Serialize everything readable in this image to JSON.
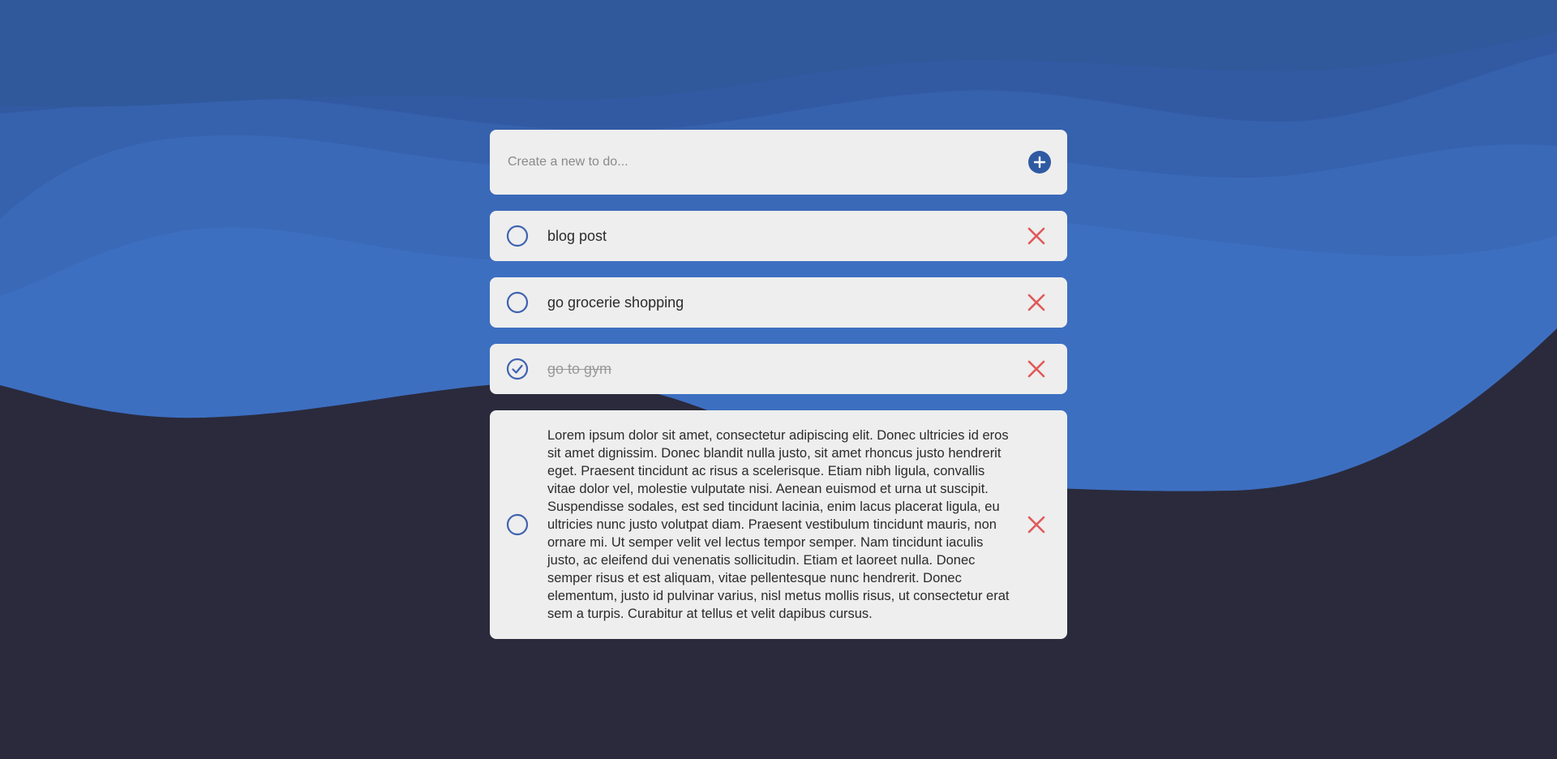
{
  "colors": {
    "background_dark": "#2a2a3c",
    "wave_primary": "#3d6fc1",
    "card_bg": "#eeeeee",
    "accent": "#2f5aa3",
    "check_ring": "#3f63b0",
    "delete": "#e05a5a"
  },
  "new_todo": {
    "placeholder": "Create a new to do...",
    "value": "",
    "add_icon": "plus-circle-icon"
  },
  "todos": [
    {
      "text": "blog post",
      "completed": false
    },
    {
      "text": "go grocerie shopping",
      "completed": false
    },
    {
      "text": "go to gym",
      "completed": true
    },
    {
      "text": "Lorem ipsum dolor sit amet, consectetur adipiscing elit. Donec ultricies id eros sit amet dignissim. Donec blandit nulla justo, sit amet rhoncus justo hendrerit eget. Praesent tincidunt ac risus a scelerisque. Etiam nibh ligula, convallis vitae dolor vel, molestie vulputate nisi. Aenean euismod et urna ut suscipit. Suspendisse sodales, est sed tincidunt lacinia, enim lacus placerat ligula, eu ultricies nunc justo volutpat diam. Praesent vestibulum tincidunt mauris, non ornare mi. Ut semper velit vel lectus tempor semper. Nam tincidunt iaculis justo, ac eleifend dui venenatis sollicitudin. Etiam et laoreet nulla. Donec semper risus et est aliquam, vitae pellentesque nunc hendrerit. Donec elementum, justo id pulvinar varius, nisl metus mollis risus, ut consectetur erat sem a turpis. Curabitur at tellus et velit dapibus cursus.",
      "completed": false
    }
  ],
  "icons": {
    "unchecked": "circle-icon",
    "checked": "check-circle-icon",
    "delete": "close-icon"
  }
}
